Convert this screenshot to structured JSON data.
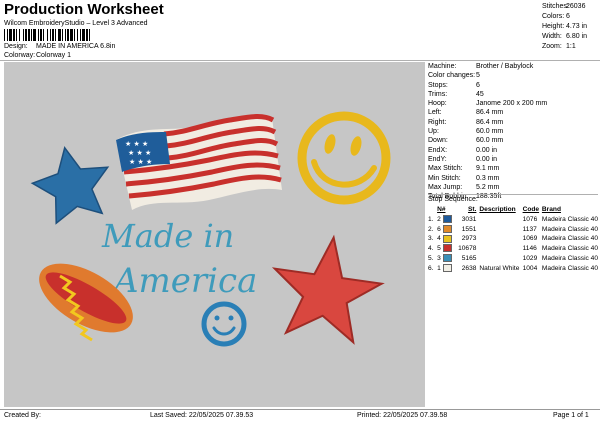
{
  "header": {
    "title": "Production Worksheet",
    "subtitle": "Wilcom EmbroideryStudio – Level 3 Advanced",
    "design_label": "Design:",
    "design_value": "MADE IN AMERICA 6.8in",
    "colorway_label": "Colorway:",
    "colorway_value": "Colorway 1"
  },
  "stats": [
    {
      "label": "Stitches:",
      "value": "26036"
    },
    {
      "label": "Colors:",
      "value": "6"
    },
    {
      "label": "Height:",
      "value": "4.73 in"
    },
    {
      "label": "Width:",
      "value": "6.80 in"
    },
    {
      "label": "Zoom:",
      "value": "1:1"
    }
  ],
  "properties": [
    {
      "label": "Machine:",
      "value": "Brother / Babylock"
    },
    {
      "label": "Color changes:",
      "value": "5"
    },
    {
      "label": "Stops:",
      "value": "6"
    },
    {
      "label": "Trims:",
      "value": "45"
    },
    {
      "label": "Hoop:",
      "value": "Janome 200 x 200 mm"
    },
    {
      "label": "Left:",
      "value": "86.4 mm"
    },
    {
      "label": "Right:",
      "value": "86.4 mm"
    },
    {
      "label": "Up:",
      "value": "60.0 mm"
    },
    {
      "label": "Down:",
      "value": "60.0 mm"
    },
    {
      "label": "EndX:",
      "value": "0.00 in"
    },
    {
      "label": "EndY:",
      "value": "0.00 in"
    },
    {
      "label": "Max Stitch:",
      "value": "9.1 mm"
    },
    {
      "label": "Min Stitch:",
      "value": "0.3 mm"
    },
    {
      "label": "Max Jump:",
      "value": "5.2 mm"
    },
    {
      "label": "Total Bobbin:",
      "value": "188.35ft"
    }
  ],
  "sequence": {
    "title": "Stop Sequence:",
    "headers": [
      "N#",
      "St.",
      "Description",
      "Code",
      "Brand"
    ],
    "rows": [
      {
        "stop": "1.",
        "n": "2",
        "color": "#1e5a9c",
        "st": "3031",
        "desc": "",
        "code": "1076",
        "brand": "Madeira Classic 40"
      },
      {
        "stop": "2.",
        "n": "6",
        "color": "#e08a2a",
        "st": "1551",
        "desc": "",
        "code": "1137",
        "brand": "Madeira Classic 40"
      },
      {
        "stop": "3.",
        "n": "4",
        "color": "#e8c21f",
        "st": "2973",
        "desc": "",
        "code": "1069",
        "brand": "Madeira Classic 40"
      },
      {
        "stop": "4.",
        "n": "5",
        "color": "#c8302c",
        "st": "10678",
        "desc": "",
        "code": "1146",
        "brand": "Madeira Classic 40"
      },
      {
        "stop": "5.",
        "n": "3",
        "color": "#3a8fb7",
        "st": "5165",
        "desc": "",
        "code": "1029",
        "brand": "Madeira Classic 40"
      },
      {
        "stop": "6.",
        "n": "1",
        "color": "#f2efe6",
        "st": "2638",
        "desc": "Natural White",
        "code": "1004",
        "brand": "Madeira Classic 40"
      }
    ]
  },
  "design_text": {
    "line1": "Made in",
    "line2": "America"
  },
  "footer": {
    "created": "Created By:",
    "saved": "Last Saved: 22/05/2025 07.39.53",
    "printed": "Printed: 22/05/2025 07.39.58",
    "page": "Page 1 of 1"
  }
}
